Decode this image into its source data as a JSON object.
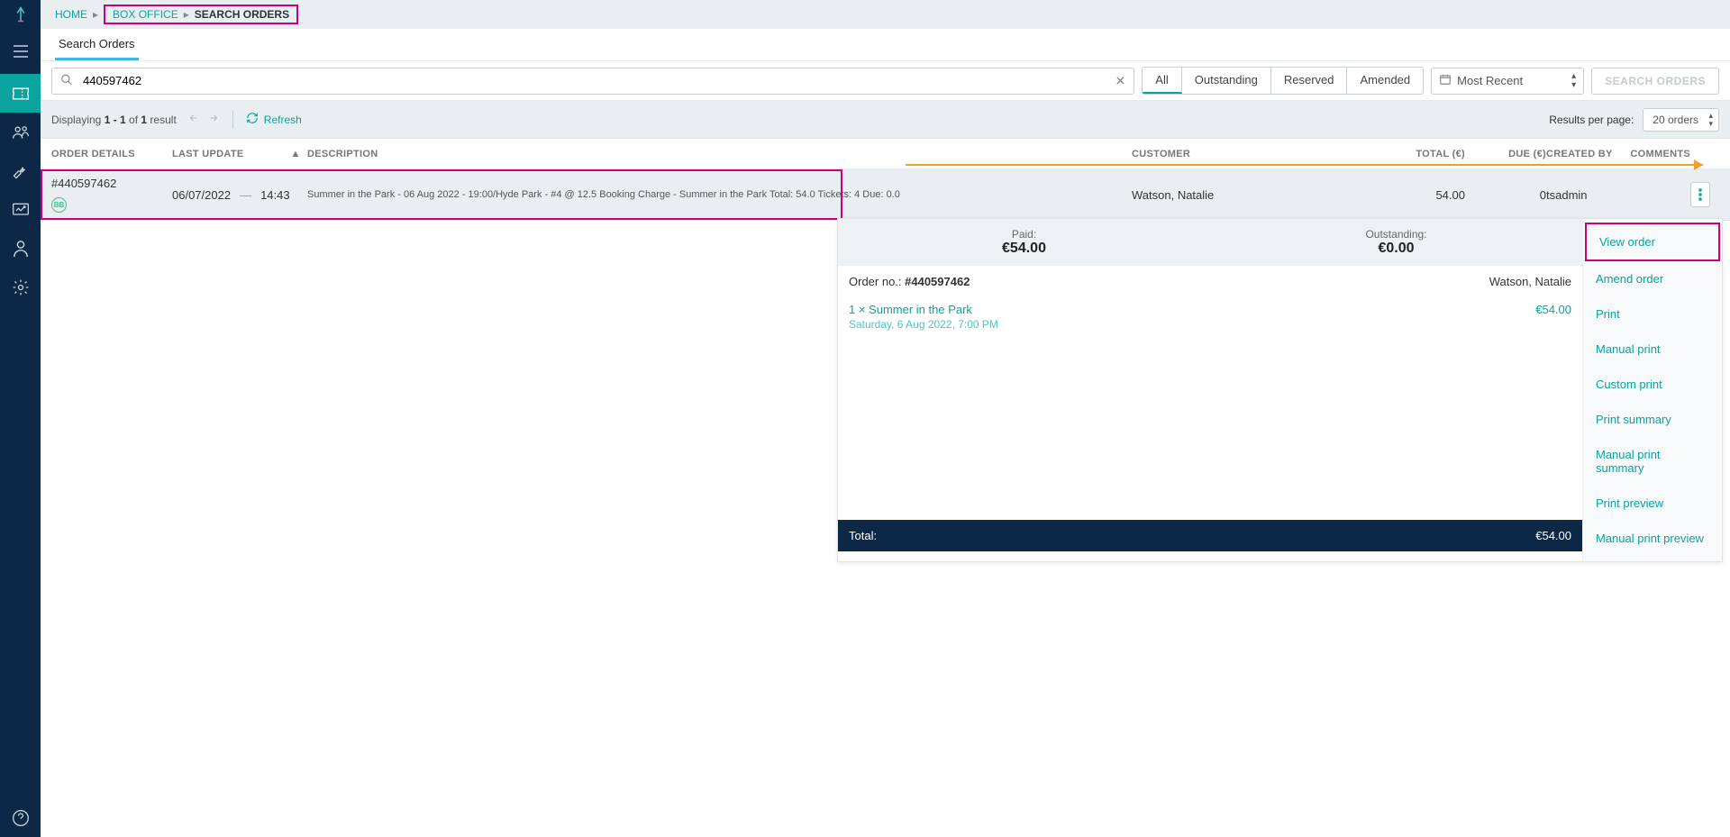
{
  "breadcrumb": {
    "home": "HOME",
    "box_office": "BOX OFFICE",
    "current": "SEARCH ORDERS"
  },
  "tab": {
    "label": "Search Orders"
  },
  "search": {
    "value": "440597462"
  },
  "filters": {
    "all": "All",
    "outstanding": "Outstanding",
    "reserved": "Reserved",
    "amended": "Amended"
  },
  "sort": {
    "label": "Most Recent"
  },
  "search_btn": "SEARCH ORDERS",
  "results_text": {
    "prefix": "Displaying ",
    "range": "1 - 1",
    "of": " of ",
    "total": "1",
    "suffix": " result"
  },
  "refresh": "Refresh",
  "rpp": {
    "label": "Results per page:",
    "value": "20 orders"
  },
  "cols": {
    "order": "ORDER DETAILS",
    "last": "LAST UPDATE",
    "desc": "DESCRIPTION",
    "cust": "CUSTOMER",
    "total": "TOTAL (€)",
    "due": "DUE (€)",
    "created": "CREATED BY",
    "comments": "COMMENTS"
  },
  "row": {
    "order_id": "#440597462",
    "date": "06/07/2022",
    "time": "14:43",
    "desc": "Summer in the Park - 06 Aug 2022 - 19:00/Hyde Park - #4 @ 12.5 Booking Charge - Summer in the Park Total: 54.0 Tickets: 4 Due: 0.0",
    "customer": "Watson, Natalie",
    "total": "54.00",
    "due": "0",
    "created_by": "tsadmin"
  },
  "popover": {
    "paid": {
      "lbl": "Paid:",
      "val": "€54.00"
    },
    "outstanding": {
      "lbl": "Outstanding:",
      "val": "€0.00"
    },
    "order_label": "Order no.: ",
    "order_no": "#440597462",
    "customer": "Watson, Natalie",
    "item": {
      "name": "1 × Summer in the Park",
      "price": "€54.00",
      "sub": "Saturday, 6 Aug 2022, 7:00 PM"
    },
    "total": {
      "lbl": "Total:",
      "val": "€54.00"
    },
    "menu": {
      "view": "View order",
      "amend": "Amend order",
      "print": "Print",
      "manual_print": "Manual print",
      "custom_print": "Custom print",
      "print_summary": "Print summary",
      "manual_print_summary": "Manual print summary",
      "print_preview": "Print preview",
      "manual_print_preview": "Manual print preview"
    }
  }
}
